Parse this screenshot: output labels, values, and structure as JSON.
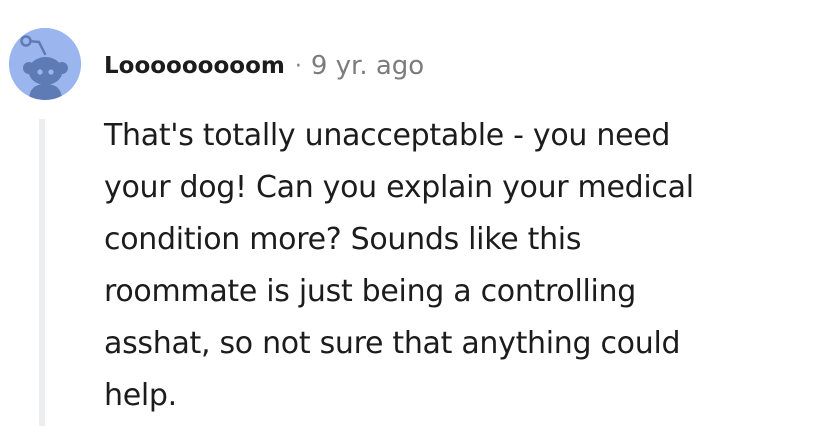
{
  "comment": {
    "author": "Looooooooom",
    "separator": "·",
    "timestamp": "9 yr. ago",
    "body_lines": [
      "That's totally unacceptable - you need",
      "your dog! Can you explain your medical",
      "condition more? Sounds like this",
      "roommate is just being a controlling",
      "asshat, so not sure that anything could",
      "help."
    ],
    "avatar_icon": "snoo-avatar-icon"
  },
  "colors": {
    "avatar_background": "#9bb6ee",
    "avatar_figure": "#5f7bb5",
    "text": "#1c1c1c",
    "muted": "#7c7c7c",
    "thread_line": "#ebedef"
  }
}
